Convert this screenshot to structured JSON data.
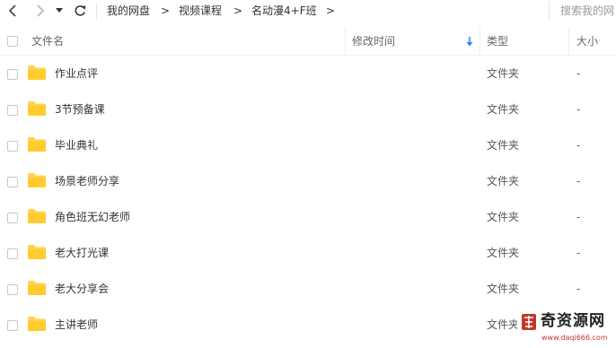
{
  "toolbar": {
    "back_icon": "chevron-left-icon",
    "forward_icon": "chevron-right-icon",
    "history_icon": "caret-down-icon",
    "refresh_icon": "refresh-icon"
  },
  "breadcrumb": {
    "items": [
      "我的网盘",
      "视频课程",
      "名动漫4+F班"
    ],
    "separator": ">"
  },
  "search": {
    "placeholder": "搜索我的网"
  },
  "columns": {
    "name": "文件名",
    "modified": "修改时间",
    "type": "类型",
    "size": "大小",
    "sort_icon": "arrow-down-icon"
  },
  "rows": [
    {
      "name": "作业点评",
      "type": "文件夹",
      "size": "-"
    },
    {
      "name": "3节预备课",
      "type": "文件夹",
      "size": "-"
    },
    {
      "name": "毕业典礼",
      "type": "文件夹",
      "size": "-"
    },
    {
      "name": "场景老师分享",
      "type": "文件夹",
      "size": "-"
    },
    {
      "name": "角色班无幻老师",
      "type": "文件夹",
      "size": "-"
    },
    {
      "name": "老大打光课",
      "type": "文件夹",
      "size": "-"
    },
    {
      "name": "老大分享会",
      "type": "文件夹",
      "size": "-"
    },
    {
      "name": "主讲老师",
      "type": "文件夹",
      "size": "-"
    }
  ],
  "colors": {
    "folder": "#ffd34f",
    "sort_accent": "#1a8ffe",
    "watermark_red": "#c0392b"
  },
  "watermark": {
    "title": "奇资源网",
    "url": "www.daqi666.com"
  }
}
